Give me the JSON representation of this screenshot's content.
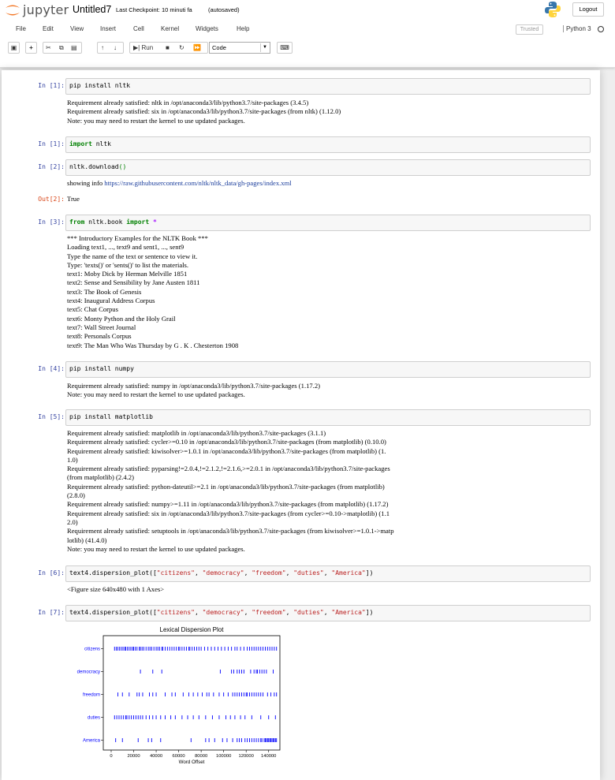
{
  "header": {
    "logo_text": "jupyter",
    "notebook_name": "Untitled7",
    "checkpoint": "Last Checkpoint: 10 minuti fa",
    "autosave": "(autosaved)",
    "logout": "Logout"
  },
  "menu": [
    "File",
    "Edit",
    "View",
    "Insert",
    "Cell",
    "Kernel",
    "Widgets",
    "Help"
  ],
  "trusted": "Trusted",
  "kernel": "Python 3",
  "toolbar": {
    "run_label": "Run",
    "cell_type": "Code"
  },
  "cells": [
    {
      "prompt": "In [1]:",
      "code": "pip install nltk",
      "output": "Requirement already satisfied: nltk in /opt/anaconda3/lib/python3.7/site-packages (3.4.5)\nRequirement already satisfied: six in /opt/anaconda3/lib/python3.7/site-packages (from nltk) (1.12.0)\nNote: you may need to restart the kernel to use updated packages."
    },
    {
      "prompt": "In [1]:",
      "code_kw": "import",
      "code_rest": " nltk"
    },
    {
      "prompt": "In [2]:",
      "code_pre": "nltk.download",
      "code_paren": "()",
      "output_pre": "showing info ",
      "output_url": "https://raw.githubusercontent.com/nltk/nltk_data/gh-pages/index.xml",
      "out_prompt": "Out[2]:",
      "out_value": "True"
    },
    {
      "prompt": "In [3]:",
      "code_kw1": "from",
      "code_mid": " nltk.book ",
      "code_kw2": "import",
      "code_star": " *",
      "output": "*** Introductory Examples for the NLTK Book ***\nLoading text1, ..., text9 and sent1, ..., sent9\nType the name of the text or sentence to view it.\nType: 'texts()' or 'sents()' to list the materials.\ntext1: Moby Dick by Herman Melville 1851\ntext2: Sense and Sensibility by Jane Austen 1811\ntext3: The Book of Genesis\ntext4: Inaugural Address Corpus\ntext5: Chat Corpus\ntext6: Monty Python and the Holy Grail\ntext7: Wall Street Journal\ntext8: Personals Corpus\ntext9: The Man Who Was Thursday by G . K . Chesterton 1908"
    },
    {
      "prompt": "In [4]:",
      "code": "pip install numpy",
      "output": "Requirement already satisfied: numpy in /opt/anaconda3/lib/python3.7/site-packages (1.17.2)\nNote: you may need to restart the kernel to use updated packages."
    },
    {
      "prompt": "In [5]:",
      "code": "pip install matplotlib",
      "output": "Requirement already satisfied: matplotlib in /opt/anaconda3/lib/python3.7/site-packages (3.1.1)\nRequirement already satisfied: cycler>=0.10 in /opt/anaconda3/lib/python3.7/site-packages (from matplotlib) (0.10.0)\nRequirement already satisfied: kiwisolver>=1.0.1 in /opt/anaconda3/lib/python3.7/site-packages (from matplotlib) (1.\n1.0)\nRequirement already satisfied: pyparsing!=2.0.4,!=2.1.2,!=2.1.6,>=2.0.1 in /opt/anaconda3/lib/python3.7/site-packages\n(from matplotlib) (2.4.2)\nRequirement already satisfied: python-dateutil>=2.1 in /opt/anaconda3/lib/python3.7/site-packages (from matplotlib)\n(2.8.0)\nRequirement already satisfied: numpy>=1.11 in /opt/anaconda3/lib/python3.7/site-packages (from matplotlib) (1.17.2)\nRequirement already satisfied: six in /opt/anaconda3/lib/python3.7/site-packages (from cycler>=0.10->matplotlib) (1.1\n2.0)\nRequirement already satisfied: setuptools in /opt/anaconda3/lib/python3.7/site-packages (from kiwisolver>=1.0.1->matp\nlotlib) (41.4.0)\nNote: you may need to restart the kernel to use updated packages."
    },
    {
      "prompt": "In [6]:",
      "output": "<Figure size 640x480 with 1 Axes>"
    },
    {
      "prompt": "In [7]:"
    }
  ],
  "dispersion_code": {
    "pre": "text4.dispersion_plot([",
    "words": [
      "\"citizens\"",
      "\"democracy\"",
      "\"freedom\"",
      "\"duties\"",
      "\"America\""
    ],
    "post": "])"
  },
  "chart_data": {
    "type": "scatter",
    "title": "Lexical Dispersion Plot",
    "xlabel": "Word Offset",
    "ylabel": "",
    "categories": [
      "citizens",
      "democracy",
      "freedom",
      "duties",
      "America"
    ],
    "xlim": [
      -7000,
      150000
    ],
    "xticks": [
      0,
      20000,
      40000,
      60000,
      80000,
      100000,
      120000,
      140000
    ],
    "colors": {
      "marks": "#0000ff",
      "labels": "#0000ff"
    },
    "series": [
      {
        "name": "citizens",
        "values": [
          3000,
          4500,
          6000,
          7500,
          9000,
          10500,
          12000,
          13000,
          14500,
          16000,
          17500,
          19000,
          20000,
          21500,
          23000,
          25000,
          26000,
          27500,
          29000,
          31000,
          33000,
          34500,
          36000,
          38000,
          40000,
          41500,
          43000,
          45000,
          46000,
          48000,
          50000,
          52000,
          54000,
          56000,
          58000,
          60000,
          61000,
          63000,
          65000,
          67000,
          69000,
          70000,
          72000,
          74000,
          76000,
          78000,
          80000,
          83000,
          86000,
          89000,
          92000,
          95000,
          98000,
          101000,
          104000,
          107000,
          110000,
          112000,
          115000,
          118000,
          121000,
          123000,
          125000,
          127000,
          129000,
          131000,
          133000,
          135000,
          137000,
          139000,
          141000,
          143000,
          145000,
          147000
        ]
      },
      {
        "name": "democracy",
        "values": [
          26000,
          37000,
          45000,
          97000,
          107000,
          109000,
          112000,
          114000,
          116000,
          118000,
          124000,
          127000,
          129000,
          130000,
          132000,
          134000,
          136000,
          138000,
          144000
        ]
      },
      {
        "name": "freedom",
        "values": [
          6000,
          10000,
          16000,
          23000,
          25000,
          28000,
          34000,
          37000,
          40000,
          48000,
          54000,
          57000,
          64000,
          69000,
          73000,
          77000,
          81000,
          85000,
          87000,
          91000,
          96000,
          100000,
          104000,
          108000,
          110000,
          112000,
          114000,
          116000,
          118000,
          120000,
          121000,
          123000,
          125000,
          127000,
          129000,
          131000,
          133000,
          135000,
          139000,
          142000,
          145000,
          147000
        ]
      },
      {
        "name": "duties",
        "values": [
          3000,
          5000,
          7000,
          9000,
          11000,
          13000,
          14000,
          16000,
          18000,
          20000,
          22000,
          24000,
          26000,
          28000,
          31000,
          34000,
          37000,
          40000,
          44000,
          48000,
          53000,
          57000,
          63000,
          68000,
          73000,
          78000,
          84000,
          90000,
          96000,
          102000,
          106000,
          110000,
          115000,
          119000,
          125000,
          133000,
          140000,
          146000
        ]
      },
      {
        "name": "America",
        "values": [
          4000,
          10000,
          24000,
          33000,
          36000,
          44000,
          71000,
          84000,
          87000,
          92000,
          99000,
          103000,
          108000,
          112000,
          114000,
          116000,
          119000,
          121000,
          123000,
          125000,
          127000,
          129000,
          131000,
          133000,
          134000,
          136000,
          137000,
          138000,
          139000,
          140000,
          141000,
          142000,
          143000,
          144000,
          145000,
          146000,
          147000
        ]
      }
    ]
  }
}
